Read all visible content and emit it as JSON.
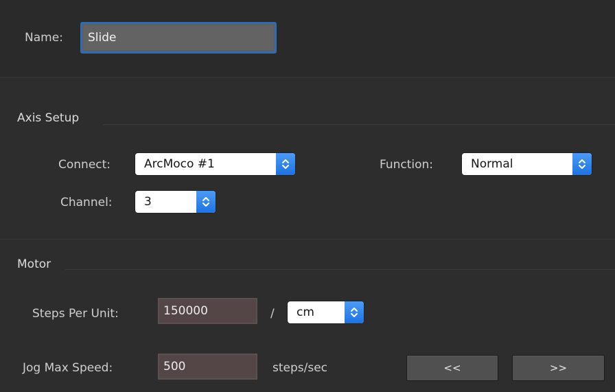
{
  "name": {
    "label": "Name:",
    "value": "Slide"
  },
  "axis_setup": {
    "title": "Axis Setup",
    "connect": {
      "label": "Connect:",
      "value": "ArcMoco #1"
    },
    "function": {
      "label": "Function:",
      "value": "Normal"
    },
    "channel": {
      "label": "Channel:",
      "value": "3"
    }
  },
  "motor": {
    "title": "Motor",
    "steps_per_unit": {
      "label": "Steps Per Unit:",
      "value": "150000",
      "separator": "/",
      "unit": "cm"
    },
    "jog_max_speed": {
      "label": "Jog Max Speed:",
      "value": "500",
      "unit": "steps/sec"
    },
    "jog_back_label": "<<",
    "jog_forward_label": ">>"
  },
  "colors": {
    "accent": "#2f6db0",
    "popup_arrow": "#1e73e3",
    "background": "#2d2d2d"
  },
  "icons": {
    "popup_arrow": "up-down-chevron-icon"
  }
}
